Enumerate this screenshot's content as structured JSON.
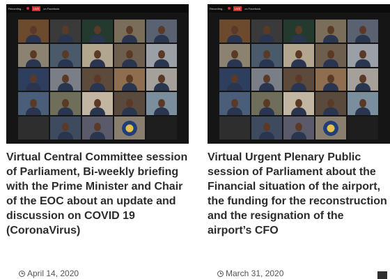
{
  "zoom_bar": {
    "recording_label": "Recording...",
    "live_label": "LIVE",
    "platform_label": "on Facebook"
  },
  "posts": [
    {
      "title": "Virtual Central Committee session of Parliament, Bi-weekly briefing with the Prime Minister and Chair of the EOC about an update and discussion on COVID 19 (CoronaVirus)",
      "date": "April 14, 2020",
      "tile_colors": [
        "#6b4a2e",
        "#3a3a3a",
        "#243a2e",
        "#7a6e5a",
        "#5a6272",
        "#8c8272",
        "#4a5a6a",
        "#b2a68e",
        "#6e5e4e",
        "#9aa0a6",
        "#2e3e5e",
        "#7a7e86",
        "#5e4a3a",
        "#8e6e4e",
        "#a6a09a",
        "#4a5e7a",
        "#6e6e5a",
        "#c2b6a2",
        "#5a4a3e",
        "#7a8e9e",
        "#2e2e2e",
        "#3e4a5e",
        "#5a5a6a",
        "#8a7e6e",
        "#1e1e1e"
      ]
    },
    {
      "title": "Virtual Urgent Plenary Public session of Parliament about the Financial situation of the airport, the funding for the reconstruction and the resignation of the airport’s CFO",
      "date": "March 31, 2020",
      "tile_colors": [
        "#6b4a2e",
        "#3a3a3a",
        "#243a2e",
        "#7a6e5a",
        "#5a6272",
        "#8c8272",
        "#4a5a6a",
        "#b2a68e",
        "#6e5e4e",
        "#9aa0a6",
        "#2e3e5e",
        "#7a7e86",
        "#5e4a3a",
        "#8e6e4e",
        "#a6a09a",
        "#4a5e7a",
        "#6e6e5a",
        "#c2b6a2",
        "#5a4a3e",
        "#7a8e9e",
        "#2e2e2e",
        "#3e4a5e",
        "#5a5a6a",
        "#8a7e6e",
        "#1e1e1e"
      ]
    }
  ]
}
